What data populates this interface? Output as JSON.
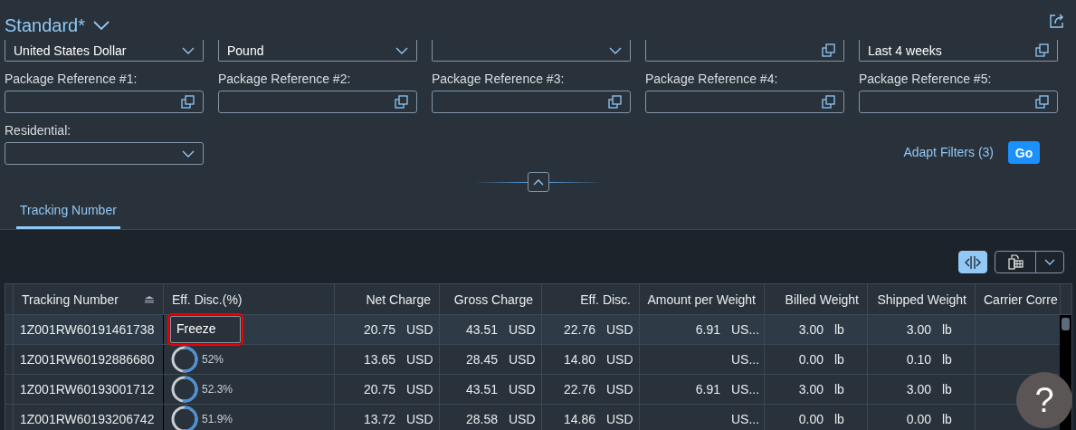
{
  "header": {
    "title": "Standard*"
  },
  "filters": [
    {
      "kind": "select",
      "value": "United States Dollar"
    },
    {
      "kind": "select",
      "value": "Pound"
    },
    {
      "kind": "select"
    },
    {
      "kind": "valuehelp"
    },
    {
      "kind": "valuehelp",
      "value": "Last 4 weeks"
    },
    {
      "kind": "valuehelp",
      "label": "Package Reference #1:"
    },
    {
      "kind": "valuehelp",
      "label": "Package Reference #2:"
    },
    {
      "kind": "valuehelp",
      "label": "Package Reference #3:"
    },
    {
      "kind": "valuehelp",
      "label": "Package Reference #4:"
    },
    {
      "kind": "valuehelp",
      "label": "Package Reference #5:"
    },
    {
      "kind": "select",
      "label": "Residential:"
    }
  ],
  "adapt_filters": "Adapt Filters (3)",
  "go_button": "Go",
  "tabs": [
    {
      "label": "Tracking Number",
      "selected": true
    }
  ],
  "toolbar": {
    "column_resize_on": true
  },
  "table": {
    "columns": [
      {
        "label": "Tracking Number",
        "sorted": true
      },
      {
        "label": "Eff. Disc.(%)",
        "sorted": false
      },
      {
        "label": "Net Charge",
        "sorted": false
      },
      {
        "label": "Gross Charge",
        "sorted": false
      },
      {
        "label": "Eff. Disc.",
        "sorted": false
      },
      {
        "label": "Amount per Weight",
        "sorted": false
      },
      {
        "label": "Billed Weight",
        "sorted": false
      },
      {
        "label": "Shipped Weight",
        "sorted": false
      },
      {
        "label": "Carrier Corre",
        "sorted": false
      }
    ],
    "rows": [
      {
        "selected": true,
        "cells": [
          {
            "kind": "text",
            "text": "1Z001RW60191461738"
          },
          {
            "kind": "input",
            "value": "Freeze",
            "invalid": true
          },
          {
            "kind": "amount",
            "amount": "20.75",
            "unit": "USD"
          },
          {
            "kind": "amount",
            "amount": "43.51",
            "unit": "USD"
          },
          {
            "kind": "amount",
            "amount": "22.76",
            "unit": "USD"
          },
          {
            "kind": "amount",
            "amount": "6.91",
            "unit": "US..."
          },
          {
            "kind": "amount",
            "amount": "3.00",
            "unit": "lb"
          },
          {
            "kind": "amount",
            "amount": "3.00",
            "unit": "lb"
          },
          ""
        ]
      },
      {
        "selected": false,
        "cells": [
          {
            "kind": "text",
            "text": "1Z001RW60192886680"
          },
          {
            "kind": "ring",
            "level": 0.52,
            "text": "52%"
          },
          {
            "kind": "amount",
            "amount": "13.65",
            "unit": "USD"
          },
          {
            "kind": "amount",
            "amount": "28.45",
            "unit": "USD"
          },
          {
            "kind": "amount",
            "amount": "14.80",
            "unit": "USD"
          },
          {
            "kind": "amount",
            "unit": "US..."
          },
          {
            "kind": "amount",
            "amount": "0.00",
            "unit": "lb"
          },
          {
            "kind": "amount",
            "amount": "0.10",
            "unit": "lb"
          },
          ""
        ]
      },
      {
        "selected": false,
        "cells": [
          {
            "kind": "text",
            "text": "1Z001RW60193001712"
          },
          {
            "kind": "ring",
            "level": 0.523,
            "text": "52.3%"
          },
          {
            "kind": "amount",
            "amount": "20.75",
            "unit": "USD"
          },
          {
            "kind": "amount",
            "amount": "43.51",
            "unit": "USD"
          },
          {
            "kind": "amount",
            "amount": "22.76",
            "unit": "USD"
          },
          {
            "kind": "amount",
            "amount": "6.91",
            "unit": "US..."
          },
          {
            "kind": "amount",
            "amount": "3.00",
            "unit": "lb"
          },
          {
            "kind": "amount",
            "amount": "3.00",
            "unit": "lb"
          },
          ""
        ]
      },
      {
        "selected": false,
        "cells": [
          {
            "kind": "text",
            "text": "1Z001RW60193206742"
          },
          {
            "kind": "ring",
            "level": 0.519,
            "text": "51.9%"
          },
          {
            "kind": "amount",
            "amount": "13.72",
            "unit": "USD"
          },
          {
            "kind": "amount",
            "amount": "28.58",
            "unit": "USD"
          },
          {
            "kind": "amount",
            "amount": "14.86",
            "unit": "USD"
          },
          {
            "kind": "amount",
            "unit": "US..."
          },
          {
            "kind": "amount",
            "amount": "0.00",
            "unit": "lb"
          },
          {
            "kind": "amount",
            "amount": "0.00",
            "unit": "lb"
          },
          ""
        ]
      }
    ]
  },
  "help_button": "?"
}
